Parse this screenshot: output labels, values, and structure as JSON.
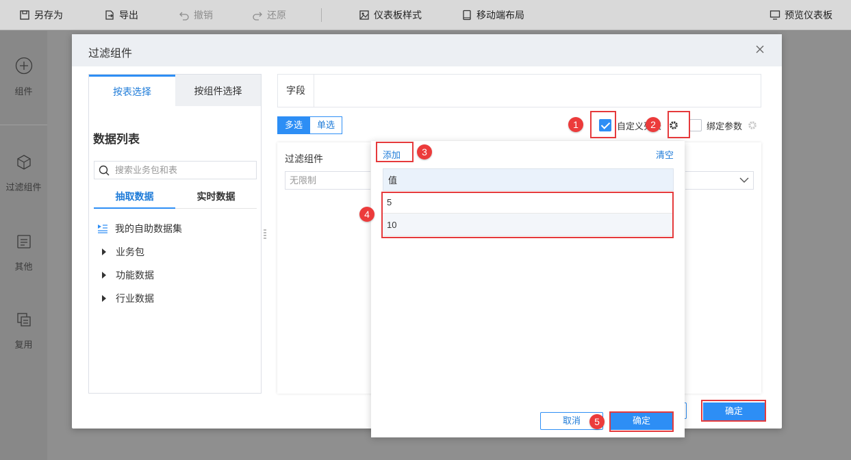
{
  "toolbar": {
    "save_as": "另存为",
    "export": "导出",
    "undo": "撤销",
    "redo": "还原",
    "dashboard_style": "仪表板样式",
    "mobile_layout": "移动端布局",
    "preview": "预览仪表板"
  },
  "leftbar": {
    "items": [
      {
        "label": "组件",
        "icon": "plus-circle-icon"
      },
      {
        "label": "过滤组件",
        "icon": "cube-icon"
      },
      {
        "label": "其他",
        "icon": "document-icon"
      },
      {
        "label": "复用",
        "icon": "copy-icon"
      }
    ]
  },
  "modal": {
    "title": "过滤组件",
    "left": {
      "tab_table": "按表选择",
      "tab_component": "按组件选择",
      "heading": "数据列表",
      "search_placeholder": "搜索业务包和表",
      "subtab_extract": "抽取数据",
      "subtab_realtime": "实时数据",
      "tree": [
        {
          "label": "我的自助数据集"
        },
        {
          "label": "业务包"
        },
        {
          "label": "功能数据"
        },
        {
          "label": "行业数据"
        }
      ]
    },
    "right": {
      "field_label": "字段",
      "multi": "多选",
      "single": "单选",
      "custom_list_label": "自定义列表",
      "bind_param_label": "绑定参数",
      "preview_label": "过滤组件",
      "preview_placeholder": "无限制"
    },
    "ok": "确定"
  },
  "popup": {
    "add": "添加",
    "clear": "清空",
    "column_header": "值",
    "values": [
      "5",
      "10"
    ],
    "cancel": "取消",
    "ok": "确定"
  },
  "annotations": [
    "1",
    "2",
    "3",
    "4",
    "5"
  ],
  "colors": {
    "accent": "#2d8ef5",
    "annotation": "#e5393b"
  }
}
